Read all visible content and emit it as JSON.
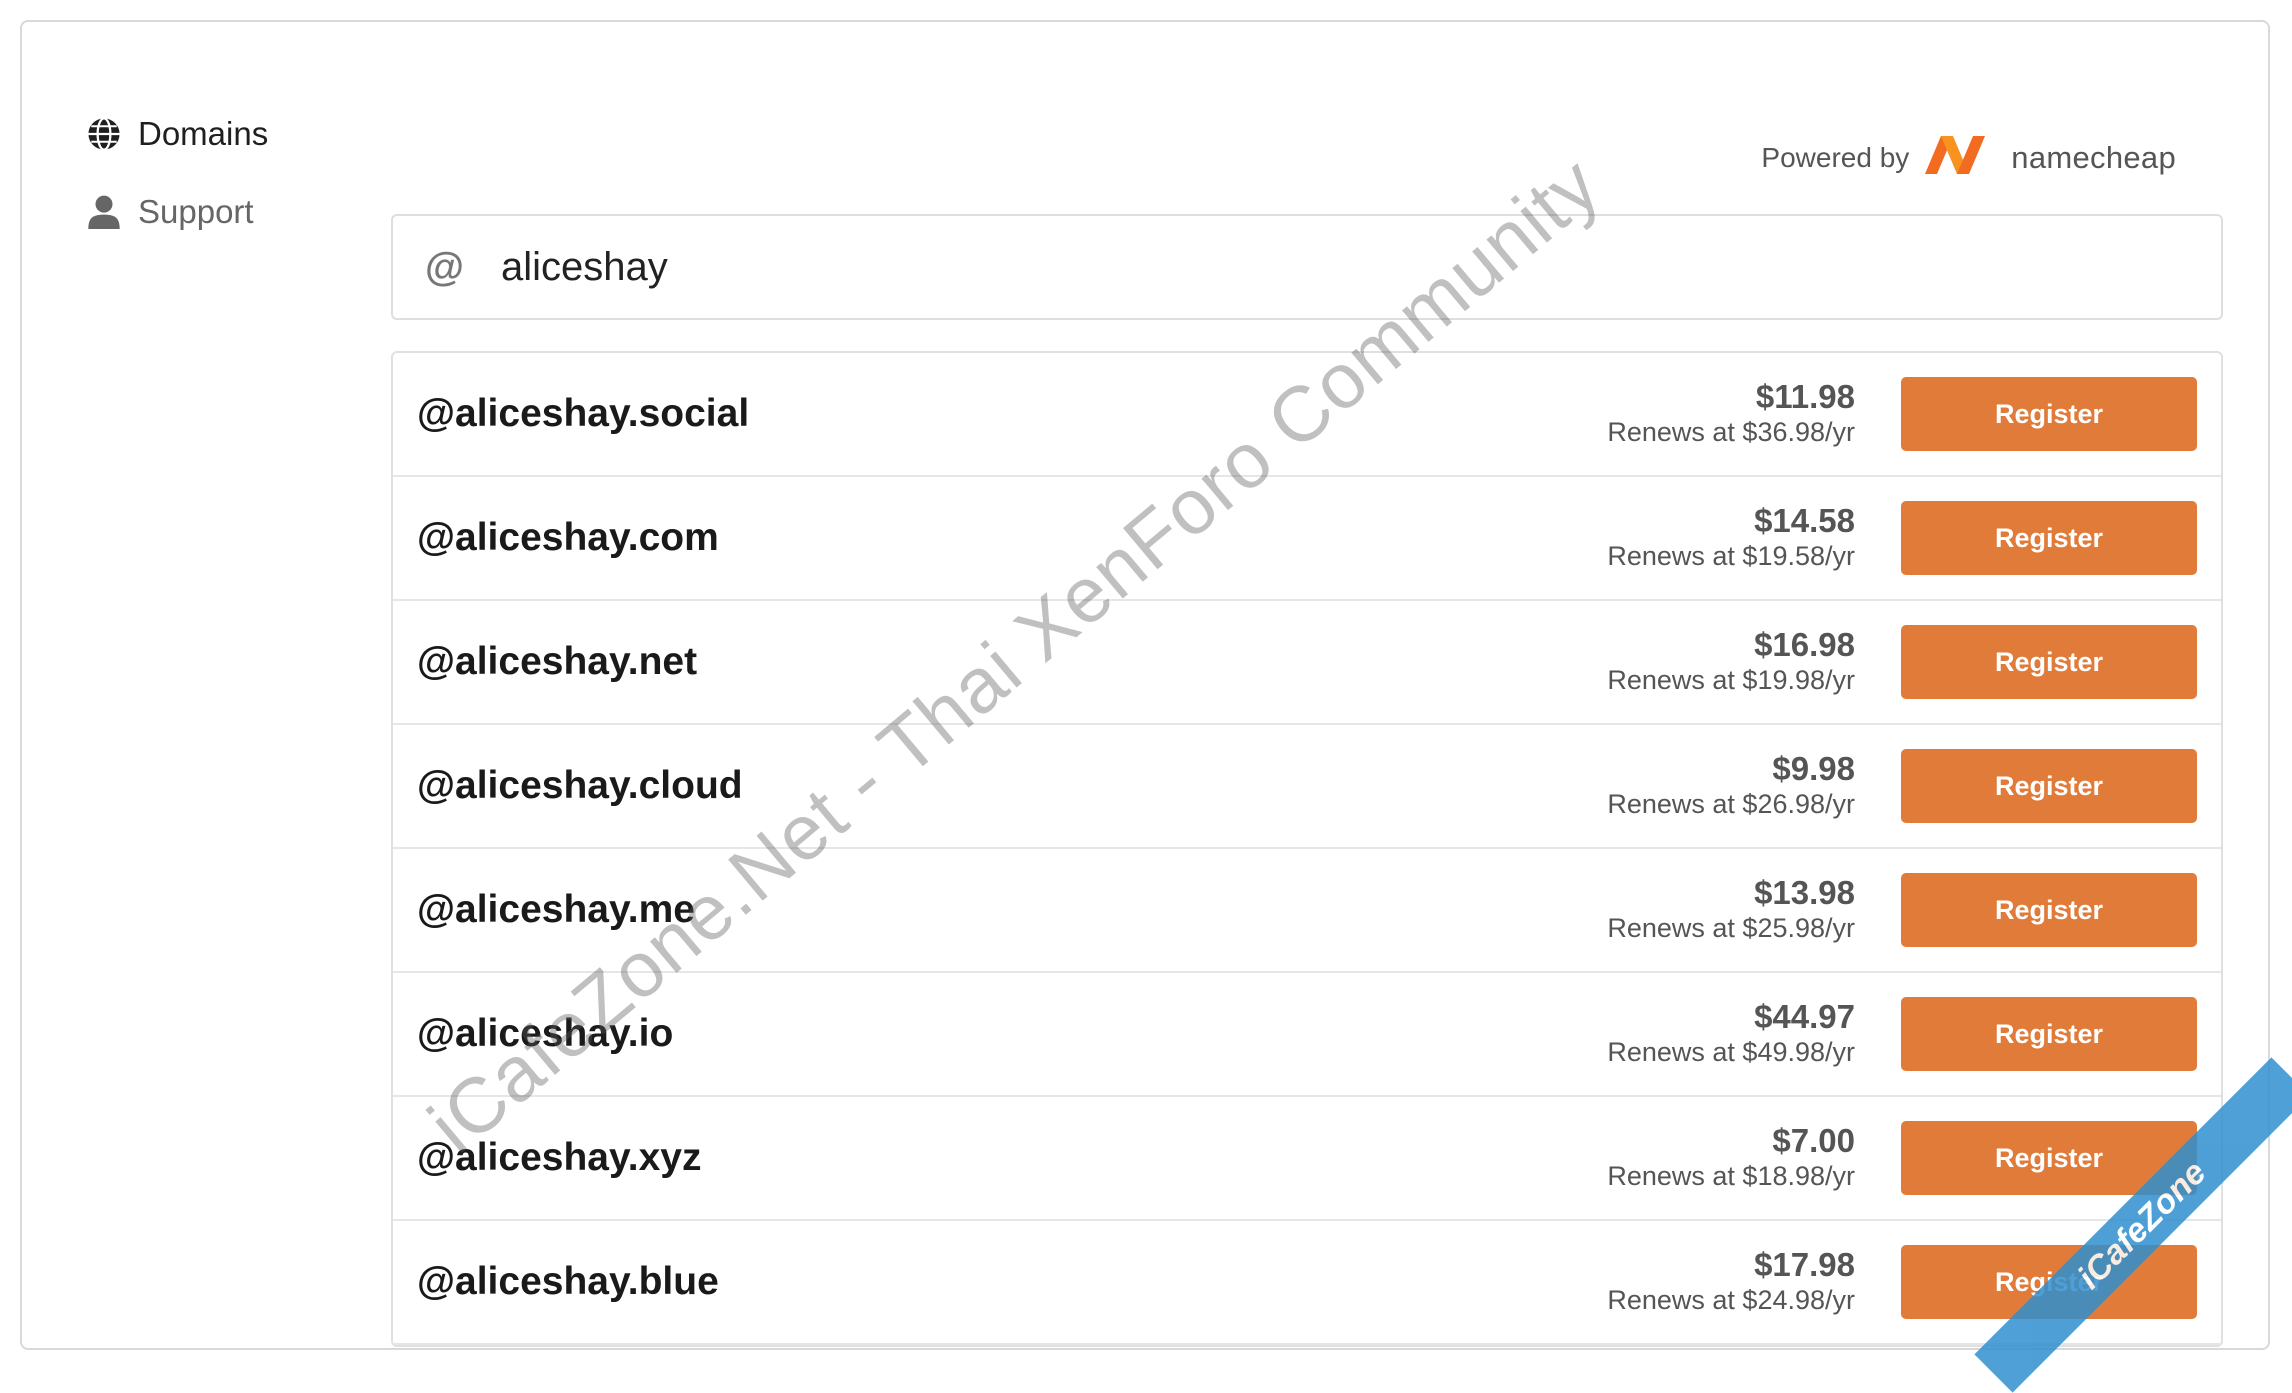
{
  "sidebar": {
    "items": [
      {
        "label": "Domains",
        "icon": "globe-icon",
        "active": true
      },
      {
        "label": "Support",
        "icon": "person-icon",
        "active": false
      }
    ]
  },
  "powered_by": {
    "label": "Powered by",
    "brand": "namecheap",
    "logo_color": "#f26b21"
  },
  "search": {
    "prefix": "@",
    "value": "aliceshay"
  },
  "results": [
    {
      "domain": "@aliceshay.social",
      "price": "$11.98",
      "renews": "Renews at $36.98/yr",
      "button": "Register"
    },
    {
      "domain": "@aliceshay.com",
      "price": "$14.58",
      "renews": "Renews at $19.58/yr",
      "button": "Register"
    },
    {
      "domain": "@aliceshay.net",
      "price": "$16.98",
      "renews": "Renews at $19.98/yr",
      "button": "Register"
    },
    {
      "domain": "@aliceshay.cloud",
      "price": "$9.98",
      "renews": "Renews at $26.98/yr",
      "button": "Register"
    },
    {
      "domain": "@aliceshay.me",
      "price": "$13.98",
      "renews": "Renews at $25.98/yr",
      "button": "Register"
    },
    {
      "domain": "@aliceshay.io",
      "price": "$44.97",
      "renews": "Renews at $49.98/yr",
      "button": "Register"
    },
    {
      "domain": "@aliceshay.xyz",
      "price": "$7.00",
      "renews": "Renews at $18.98/yr",
      "button": "Register"
    },
    {
      "domain": "@aliceshay.blue",
      "price": "$17.98",
      "renews": "Renews at $24.98/yr",
      "button": "Register"
    }
  ],
  "colors": {
    "accent": "#e07b3a",
    "text_dark": "#1a1a1a",
    "text_muted": "#555555",
    "border": "#e0e0e0"
  },
  "watermark": {
    "text": "iCafeZone.Net - Thai XenForo Community",
    "corner": "iCafeZone"
  }
}
